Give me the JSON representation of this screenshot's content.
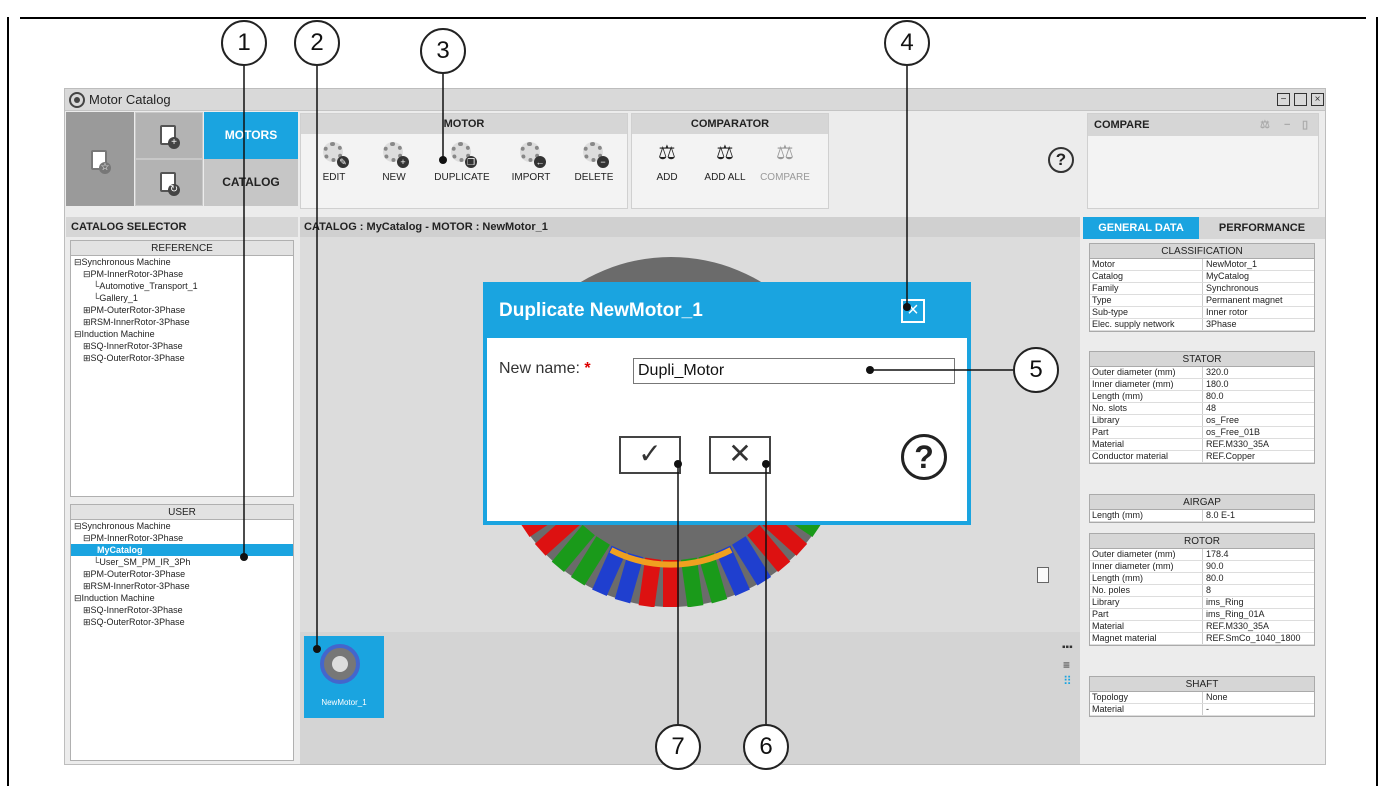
{
  "window": {
    "title": "Motor Catalog"
  },
  "ribbon": {
    "tabs": {
      "motors": "MOTORS",
      "catalog": "CATALOG"
    },
    "motor_group": {
      "title": "MOTOR",
      "buttons": [
        "EDIT",
        "NEW",
        "DUPLICATE",
        "IMPORT",
        "DELETE"
      ]
    },
    "comparator_group": {
      "title": "COMPARATOR",
      "buttons": [
        "ADD",
        "ADD ALL",
        "COMPARE"
      ]
    },
    "help": "?"
  },
  "compare_panel": {
    "title": "COMPARE"
  },
  "catalog_selector": {
    "title": "CATALOG SELECTOR",
    "reference": {
      "header": "REFERENCE",
      "items": [
        "Synchronous Machine",
        "PM-InnerRotor-3Phase",
        "Automotive_Transport_1",
        "Gallery_1",
        "PM-OuterRotor-3Phase",
        "RSM-InnerRotor-3Phase",
        "Induction Machine",
        "SQ-InnerRotor-3Phase",
        "SQ-OuterRotor-3Phase"
      ]
    },
    "user": {
      "header": "USER",
      "items": [
        "Synchronous Machine",
        "PM-InnerRotor-3Phase",
        "MyCatalog",
        "User_SM_PM_IR_3Ph",
        "PM-OuterRotor-3Phase",
        "RSM-InnerRotor-3Phase",
        "Induction Machine",
        "SQ-InnerRotor-3Phase",
        "SQ-OuterRotor-3Phase"
      ]
    }
  },
  "center": {
    "breadcrumb": "CATALOG : MyCatalog   -   MOTOR : NewMotor_1",
    "thumbnail_label": "NewMotor_1"
  },
  "right_panel": {
    "tabs": {
      "general": "GENERAL DATA",
      "performance": "PERFORMANCE"
    },
    "classification": {
      "title": "CLASSIFICATION",
      "rows": [
        [
          "Motor",
          "NewMotor_1"
        ],
        [
          "Catalog",
          "MyCatalog"
        ],
        [
          "Family",
          "Synchronous"
        ],
        [
          "Type",
          "Permanent magnet"
        ],
        [
          "Sub-type",
          "Inner rotor"
        ],
        [
          "Elec. supply network",
          "3Phase"
        ]
      ]
    },
    "stator": {
      "title": "STATOR",
      "rows": [
        [
          "Outer diameter (mm)",
          "320.0"
        ],
        [
          "Inner diameter (mm)",
          "180.0"
        ],
        [
          "Length (mm)",
          "80.0"
        ],
        [
          "No. slots",
          "48"
        ],
        [
          "Library",
          "os_Free"
        ],
        [
          "Part",
          "os_Free_01B"
        ],
        [
          "Material",
          "REF.M330_35A"
        ],
        [
          "Conductor material",
          "REF.Copper"
        ]
      ]
    },
    "airgap": {
      "title": "AIRGAP",
      "rows": [
        [
          "Length (mm)",
          "8.0 E-1"
        ]
      ]
    },
    "rotor": {
      "title": "ROTOR",
      "rows": [
        [
          "Outer diameter (mm)",
          "178.4"
        ],
        [
          "Inner diameter (mm)",
          "90.0"
        ],
        [
          "Length (mm)",
          "80.0"
        ],
        [
          "No. poles",
          "8"
        ],
        [
          "Library",
          "ims_Ring"
        ],
        [
          "Part",
          "ims_Ring_01A"
        ],
        [
          "Material",
          "REF.M330_35A"
        ],
        [
          "Magnet material",
          "REF.SmCo_1040_1800"
        ]
      ]
    },
    "shaft": {
      "title": "SHAFT",
      "rows": [
        [
          "Topology",
          "None"
        ],
        [
          "Material",
          "-"
        ]
      ]
    }
  },
  "dialog": {
    "title": "Duplicate NewMotor_1",
    "name_label": "New name:",
    "required_mark": "*",
    "name_value": "Dupli_Motor",
    "help": "?"
  },
  "callouts": [
    "1",
    "2",
    "3",
    "4",
    "5",
    "6",
    "7"
  ],
  "colors": {
    "accent": "#1aa4e0",
    "ribbon_gray": "#d6d6d6"
  }
}
